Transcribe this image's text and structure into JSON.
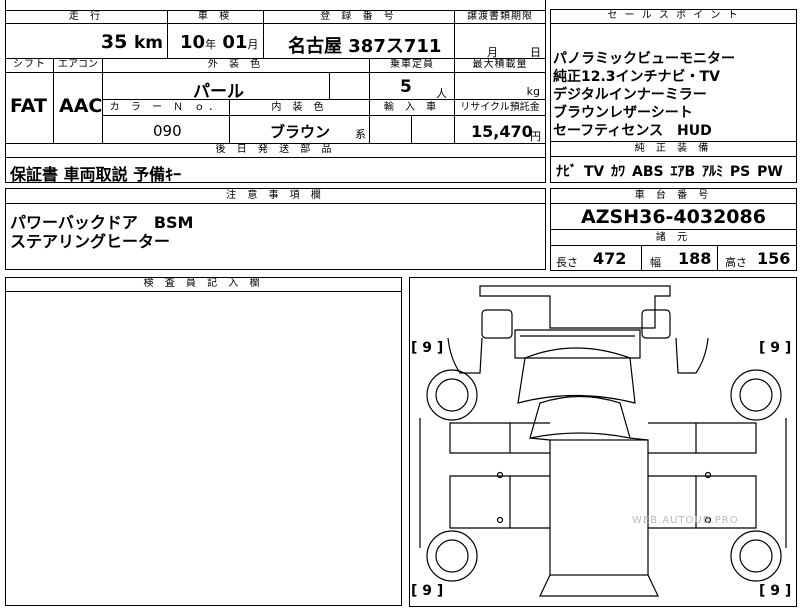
{
  "headers": {
    "mileage": "走 行",
    "inspection": "車 検",
    "registration": "登 録 番 号",
    "transfer_deadline": "譲渡書類期限",
    "sales_point": "セ ー ル ス ポ イ ン ト",
    "shift": "シフト",
    "aircon": "エアコン",
    "exterior_color": "外 装 色",
    "capacity": "乗車定員",
    "max_load": "最大積載量",
    "color_no": "カ ラ ー Ｎ ｏ．",
    "interior_color": "内 装 色",
    "import": "輸 入 車",
    "recycle": "リサイクル預託金",
    "standard_equipment": "純 正 装 備",
    "later_parts": "後 日 発 送 部 品",
    "notes": "注 意 事 項 欄",
    "chassis_no": "車 台 番 号",
    "specs": "諸 元",
    "inspector": "検 査 員 記 入 欄"
  },
  "values": {
    "mileage_num": "35",
    "mileage_unit": "km",
    "inspection_year": "10",
    "inspection_year_unit": "年",
    "inspection_month": "01",
    "inspection_month_unit": "月",
    "registration": "名古屋 387ス711",
    "transfer_month": "月",
    "transfer_day": "日",
    "shift": "FAT",
    "aircon": "AAC",
    "exterior_color": "パール",
    "capacity": "5",
    "capacity_unit": "人",
    "max_load_unit": "kg",
    "color_no": "090",
    "interior_color": "ブラウン",
    "interior_suffix": "系",
    "recycle": "15,470",
    "recycle_unit": "円",
    "later_parts": "保証書 車両取説 予備ｷｰ",
    "chassis_no": "AZSH36-4032086",
    "length_label": "長さ",
    "length": "472",
    "width_label": "幅",
    "width": "188",
    "height_label": "高さ",
    "height": "156"
  },
  "sales_points": [
    "パノラミックビューモニター",
    "純正12.3インチナビ・TV",
    "デジタルインナーミラー",
    "ブラウンレザーシート",
    "セーフティセンス　HUD"
  ],
  "equipment": [
    "ﾅﾋﾞ",
    "TV",
    "ｶﾜ",
    "ABS",
    "ｴｱB",
    "ｱﾙﾐ",
    "PS",
    "PW"
  ],
  "notes": [
    "パワーバックドア　BSM",
    "ステアリングヒーター"
  ],
  "diagram": {
    "tag_tl": "[ 9 ]",
    "tag_tr": "[ 9 ]",
    "tag_bl": "[ 9 ]",
    "tag_br": "[ 9 ]",
    "watermark": "WEB.AUTOUB.PRO"
  }
}
